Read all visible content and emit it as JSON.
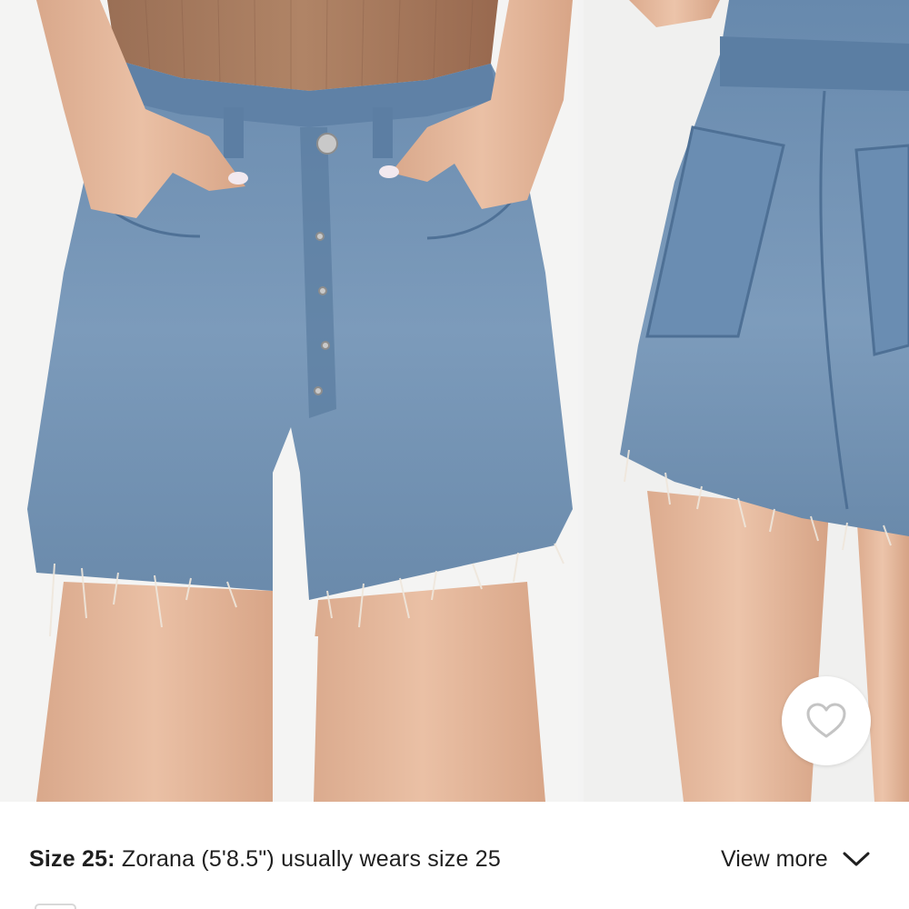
{
  "product_gallery": {
    "images": [
      {
        "view": "front",
        "alt": ""
      },
      {
        "view": "back",
        "alt": ""
      }
    ],
    "wishlist": {
      "icon": "heart-outline-icon"
    }
  },
  "fit_info": {
    "size_label": "Size 25:",
    "model_text": " Zorana (5'8.5\") usually wears size 25",
    "view_more_label": "View more",
    "view_more_icon": "chevron-down-icon"
  },
  "colors": {
    "text": "#1f1f1f",
    "denim": "#6f8fb0",
    "skin": "#e2b59a",
    "top": "#a77a5e",
    "background": "#f3f3f3"
  }
}
